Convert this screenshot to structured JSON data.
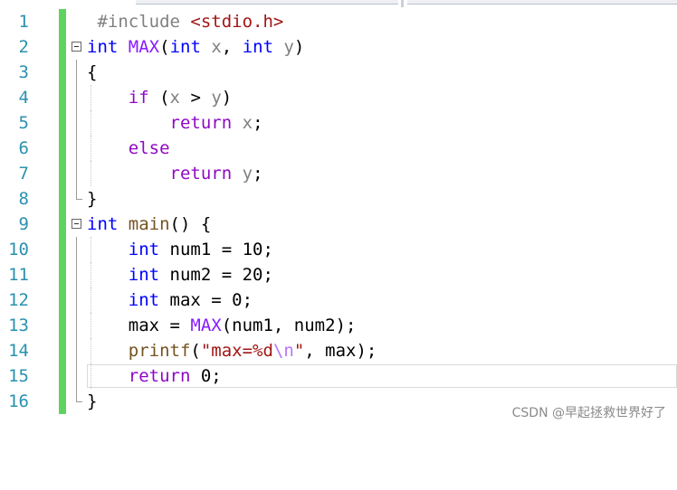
{
  "editor": {
    "line_numbers": [
      "1",
      "2",
      "3",
      "4",
      "5",
      "6",
      "7",
      "8",
      "9",
      "10",
      "11",
      "12",
      "13",
      "14",
      "15",
      "16"
    ],
    "current_line": "15"
  },
  "code": {
    "l1": {
      "directive": "#include ",
      "header": "<stdio.h>"
    },
    "l2": {
      "type": "int",
      "name": "MAX",
      "open": "(",
      "p1type": "int",
      "p1": "x",
      "comma": ", ",
      "p2type": "int",
      "p2": "y",
      "close": ")"
    },
    "l3": {
      "brace": "{"
    },
    "l4": {
      "kw": "if",
      "open": " (",
      "a": "x",
      "op": " > ",
      "b": "y",
      "close": ")"
    },
    "l5": {
      "kw": "return",
      "v": "x",
      "semi": ";"
    },
    "l6": {
      "kw": "else"
    },
    "l7": {
      "kw": "return",
      "v": "y",
      "semi": ";"
    },
    "l8": {
      "brace": "}"
    },
    "l9": {
      "type": "int",
      "name": "main",
      "rest": "() {"
    },
    "l10": {
      "type": "int",
      "rest": " num1 = 10;"
    },
    "l11": {
      "type": "int",
      "rest": " num2 = 20;"
    },
    "l12": {
      "type": "int",
      "rest": " max = 0;"
    },
    "l13": {
      "lhs": "max = ",
      "mac": "MAX",
      "rest": "(num1, num2);"
    },
    "l14": {
      "fn": "printf",
      "open": "(",
      "s1": "\"max=%d",
      "esc": "\\n",
      "s2": "\"",
      "rest": ", max);"
    },
    "l15": {
      "kw": "return",
      "rest": " 0;"
    },
    "l16": {
      "brace": "}"
    }
  },
  "watermark": "CSDN @早起拯救世界好了",
  "colors": {
    "keyword": "#0000ff",
    "control": "#8f08c4",
    "line_number": "#2b91af",
    "change_bar": "#5fd35f",
    "string": "#a31515"
  }
}
